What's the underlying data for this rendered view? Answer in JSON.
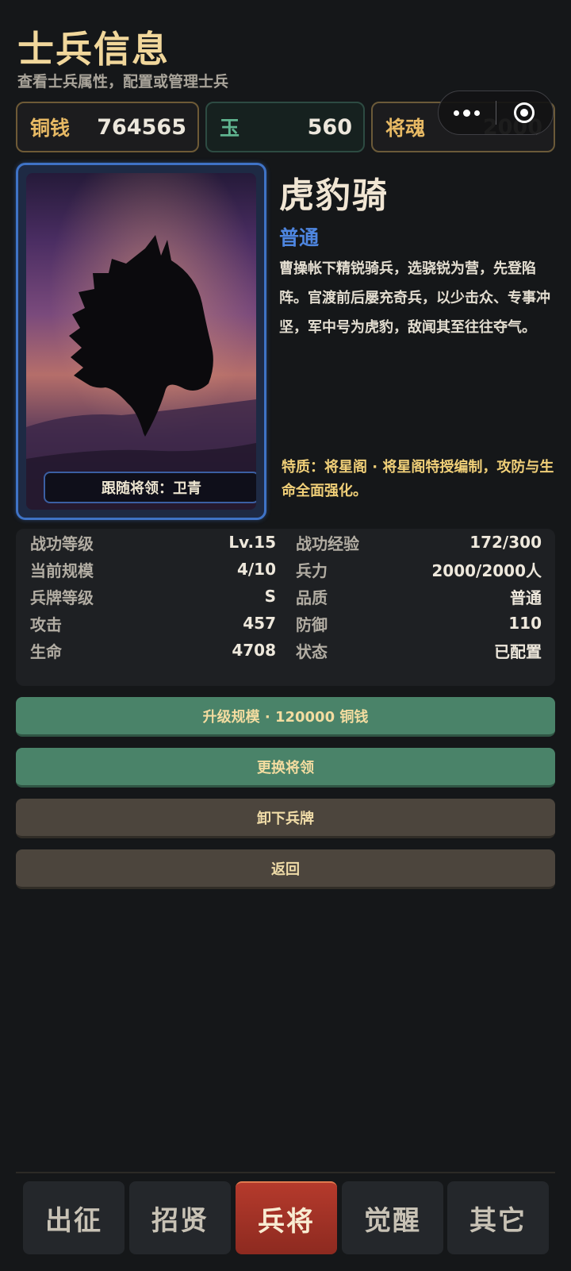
{
  "header": {
    "title": "士兵信息",
    "subtitle": "查看士兵属性，配置或管理士兵"
  },
  "currencies": [
    {
      "label": "铜钱",
      "value": "764565"
    },
    {
      "label": "玉",
      "value": "560"
    },
    {
      "label": "将魂",
      "value": "2000"
    }
  ],
  "unit": {
    "name": "虎豹骑",
    "rarity": "普通",
    "rarity_color": "#4e86e0",
    "description": "曹操帐下精锐骑兵，选骁锐为营，先登陷阵。官渡前后屡充奇兵，以少击众、专事冲坚，军中号为虎豹，敌闻其至往往夺气。",
    "trait": "特质：将星阁 · 将星阁特授编制，攻防与生命全面强化。",
    "general_label": "跟随将领：卫青",
    "portrait_icon": "horse-head-silhouette"
  },
  "stats": {
    "left": [
      {
        "k": "战功等级",
        "v": "Lv.15"
      },
      {
        "k": "当前规模",
        "v": "4/10"
      },
      {
        "k": "兵牌等级",
        "v": "S"
      },
      {
        "k": "攻击",
        "v": "457"
      },
      {
        "k": "生命",
        "v": "4708"
      }
    ],
    "right": [
      {
        "k": "战功经验",
        "v": "172/300"
      },
      {
        "k": "兵力",
        "v": "2000/2000人"
      },
      {
        "k": "品质",
        "v": "普通"
      },
      {
        "k": "防御",
        "v": "110"
      },
      {
        "k": "状态",
        "v": "已配置"
      }
    ]
  },
  "actions": {
    "upgrade": "升级规模 · 120000 铜钱",
    "change_general": "更换将领",
    "unequip": "卸下兵牌",
    "back": "返回"
  },
  "nav": {
    "tabs": [
      "出征",
      "招贤",
      "兵将",
      "觉醒",
      "其它"
    ],
    "active": "兵将"
  },
  "colors": {
    "accent_gold": "#f1d79b",
    "green_button": "#4a8369",
    "brown_button": "#4c453d",
    "active_tab": "#b53a2c"
  }
}
